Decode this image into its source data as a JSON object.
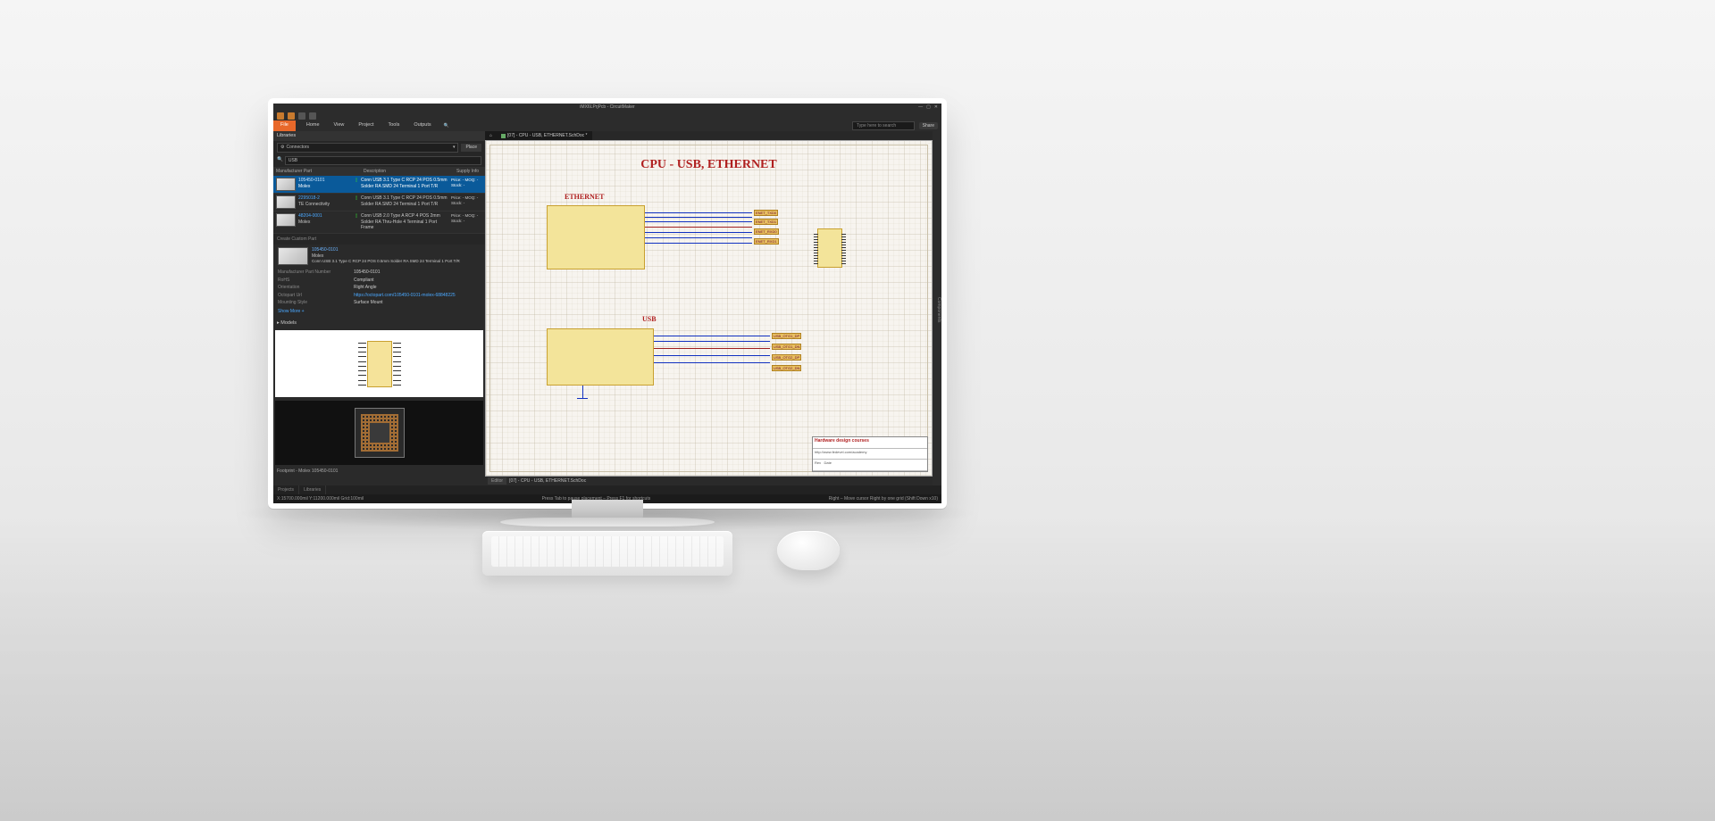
{
  "window": {
    "title": "iMX6LPrjPcb - CircuitMaker",
    "search_placeholder": "Type here to search",
    "share": "Share"
  },
  "menu": {
    "file": "File",
    "items": [
      "Home",
      "View",
      "Project",
      "Tools",
      "Outputs"
    ]
  },
  "libraries": {
    "title": "Libraries",
    "category": "Connectors",
    "place": "Place",
    "search_value": "USB",
    "headers": {
      "c1": "Manufacturer Part",
      "c2": "",
      "c3": "Description",
      "c4": "Supply Info"
    },
    "parts": [
      {
        "mpn": "105450-0101",
        "mfr": "Molex",
        "desc": "Conn USB 3.1 Type C RCP 24 POS 0.5mm Solder RA SMD 24 Terminal 1 Port T/R",
        "supply": "Price: -\nMOQ: -\nStock: -"
      },
      {
        "mpn": "2295018-2",
        "mfr": "TE Connectivity",
        "desc": "Conn USB 3.1 Type C RCP 24 POS 0.5mm Solder RA SMD 24 Terminal 1 Port T/R",
        "supply": "Price: -\nMOQ: -\nStock: -"
      },
      {
        "mpn": "48204-0001",
        "mfr": "Molex",
        "desc": "Conn USB 2.0 Type A RCP 4 POS 2mm Solder RA Thru-Hole 4 Terminal 1 Port Frame",
        "supply": "Price: -\nMOQ: -\nStock: -"
      }
    ],
    "create_custom": "Create Custom Part",
    "detail": {
      "mpn": "105450-0101",
      "mfr": "Molex",
      "desc": "Conn USB 3.1 Type C RCP 24 POS 0.5mm Solder RA SMD 24 Terminal 1 Port T/R",
      "rows": [
        {
          "k": "Manufacturer Part Number",
          "v": "105450-0101"
        },
        {
          "k": "RoHS",
          "v": "Compliant"
        },
        {
          "k": "Orientation",
          "v": "Right Angle"
        },
        {
          "k": "Octopart Url",
          "v": "https://octopart.com/105450-0101-molex-68848225",
          "link": true
        },
        {
          "k": "Mounting Style",
          "v": "Surface Mount"
        }
      ],
      "show_more": "Show More +",
      "models_hdr": "Models",
      "footprint_name": "Footprint - Molex 105450-0101"
    }
  },
  "doc": {
    "tab_home": "",
    "tab_name": "[07] - CPU - USB, ETHERNET.SchDoc *",
    "title": "CPU - USB, ETHERNET",
    "sect1": "ETHERNET",
    "sect2": "USB",
    "titleblock": {
      "l1": "Hardware design courses",
      "l2": "http://www.fedevel.com/academy",
      "l3": "Rev",
      "l4": "Date"
    }
  },
  "editor_footer": {
    "label": "Editor",
    "file": "[07] - CPU - USB, ETHERNET.SchDoc"
  },
  "status": {
    "left": "X:15700.000mil  Y:11200.000mil    Grid:100mil",
    "mid": "Press Tab to pause placement – Press F1 for shortcuts",
    "right": "Right – Move cursor Right by one grid (Shift Down x10)"
  },
  "bottom_tabs": [
    "Projects",
    "Libraries"
  ],
  "side_panel": "Components"
}
